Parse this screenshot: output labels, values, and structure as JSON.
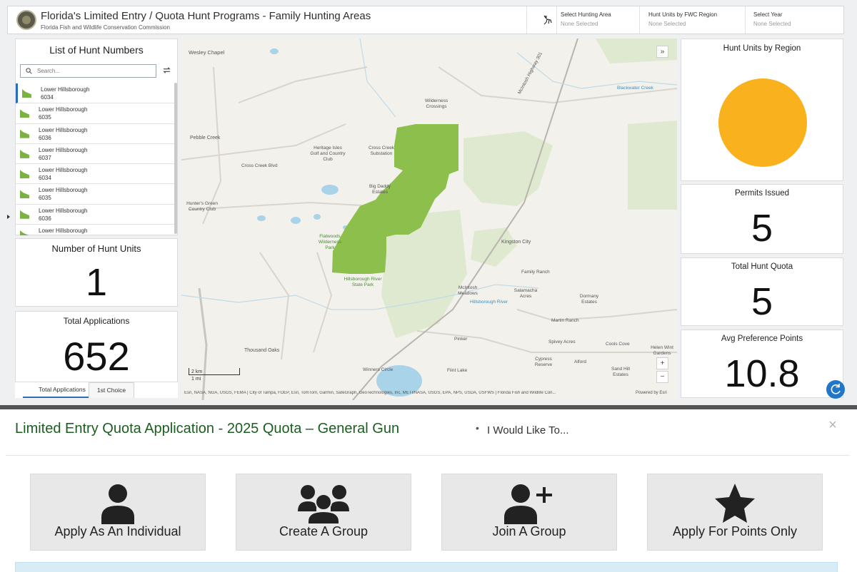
{
  "header": {
    "title": "Florida's Limited Entry / Quota Hunt Programs - Family Hunting Areas",
    "subtitle": "Florida Fish and Wildlife Conservation Commission",
    "selectors": [
      {
        "label": "Select Hunting Area",
        "value": "None Selected"
      },
      {
        "label": "Hunt Units by FWC Region",
        "value": "None Selected"
      },
      {
        "label": "Select Year",
        "value": "None Selected"
      }
    ]
  },
  "hunt_list": {
    "title": "List of Hunt Numbers",
    "search_placeholder": "Search...",
    "items": [
      {
        "name": "Lower Hillsborough",
        "number": "6034"
      },
      {
        "name": "Lower Hillsborough",
        "number": "6035"
      },
      {
        "name": "Lower Hillsborough",
        "number": "6036"
      },
      {
        "name": "Lower Hillsborough",
        "number": "6037"
      },
      {
        "name": "Lower Hillsborough",
        "number": "6034"
      },
      {
        "name": "Lower Hillsborough",
        "number": "6035"
      },
      {
        "name": "Lower Hillsborough",
        "number": "6036"
      },
      {
        "name": "Lower Hillsborough",
        "number": ""
      }
    ]
  },
  "metrics": {
    "hunt_units": {
      "label": "Number of Hunt Units",
      "value": "1"
    },
    "total_applications": {
      "label": "Total Applications",
      "value": "652"
    },
    "permits_issued": {
      "label": "Permits Issued",
      "value": "5"
    },
    "total_hunt_quota": {
      "label": "Total Hunt Quota",
      "value": "5"
    },
    "avg_preference_points": {
      "label": "Avg Preference Points",
      "value": "10.8"
    }
  },
  "tabs": [
    "Total Applications",
    "1st Choice"
  ],
  "region_chart": {
    "title": "Hunt Units by Region",
    "slice_color": "#f9b21d"
  },
  "chart_data": {
    "type": "pie",
    "title": "Hunt Units by Region",
    "values": [
      1
    ],
    "colors": [
      "#f9b21d"
    ]
  },
  "map": {
    "labels": {
      "wesley_chapel": "Wesley Chapel",
      "pebble_creek": "Pebble Creek",
      "heritage_isles": "Heritage Isles Golf and Country Club",
      "cross_creek_sub": "Cross Creek Substation",
      "cross_creek_blvd": "Cross Creek Blvd",
      "big_daddy": "Big Daddy Estates",
      "wilderness": "Wilderness Crossings",
      "hunters_green": "Hunter's Green Country Club",
      "flatwoods": "Flatwoods Wilderness Park",
      "hillsborough_park": "Hillsborough River State Park",
      "kingston": "Kingston City",
      "family_ranch": "Family Ranch",
      "mcintosh": "McIntosh Meadows",
      "salamacha": "Salamacha Acres",
      "dormany": "Dormany Estates",
      "martin_ranch": "Martin Ranch",
      "spivey": "Spivey Acres",
      "cools_cove": "Cools Cove",
      "helen_wint": "Helen Wint Gardens",
      "thousand_oaks": "Thousand Oaks",
      "winners_circle": "Winners Circle",
      "flint_lake": "Flint Lake",
      "cypress": "Cypress Reserve",
      "alford": "Alford",
      "sand_hill": "Sand Hill Estates",
      "pinker": "Pinker",
      "hillsborough_river": "Hillsborough River",
      "blackwater_creek": "Blackwater Creek",
      "mc_highway": "McIntosh Highway 301"
    },
    "scale_km": "2 km",
    "scale_mi": "1 mi",
    "attribution": "Esri, NASA, NGA, USGS, FEMA | City of Tampa, FDEP, Esri, TomTom, Garmin, SafeGraph, GeoTechnologies, Inc, METI/NASA, USGS, EPA, NPS, USDA, USFWS | Florida Fish and Wildlife Con...",
    "powered_by": "Powered by Esri",
    "zoom_in": "+",
    "zoom_out": "−",
    "collapse": "»"
  },
  "application": {
    "heading": "Limited Entry Quota Application - 2025 Quota – General Gun",
    "separator": "•",
    "prompt": "I Would Like To...",
    "close": "×",
    "options": [
      {
        "label": "Apply As An Individual",
        "icon": "person-icon"
      },
      {
        "label": "Create A Group",
        "icon": "group-icon"
      },
      {
        "label": "Join A Group",
        "icon": "person-plus-icon"
      },
      {
        "label": "Apply For Points Only",
        "icon": "star-icon"
      }
    ]
  },
  "colors": {
    "hunt_area": "#8cbf4c",
    "pie_slice": "#f9b21d",
    "heading_green": "#1b5e20",
    "accent_blue": "#2276c9"
  }
}
